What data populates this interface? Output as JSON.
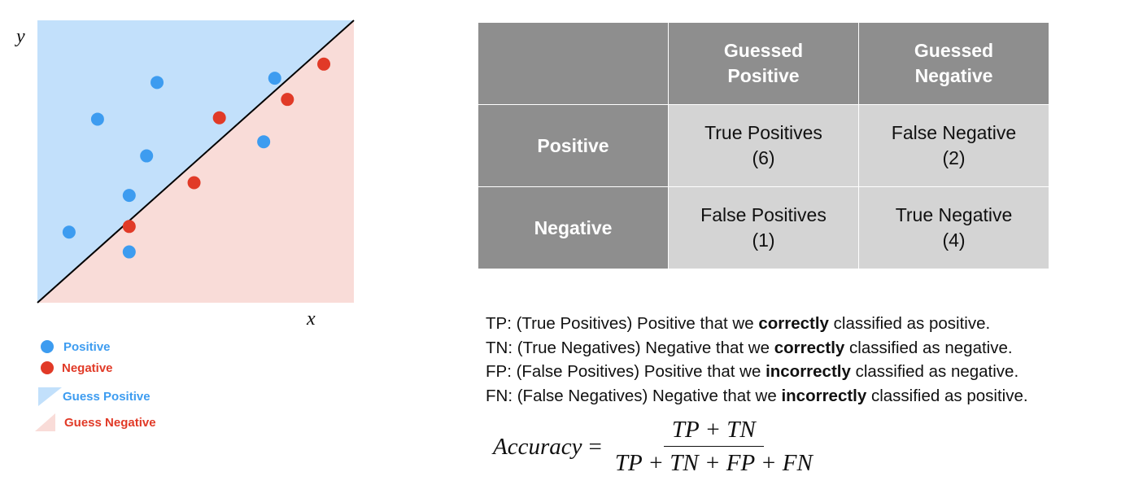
{
  "scatter": {
    "y_label": "y",
    "x_label": "x",
    "colors": {
      "positive": "#3d9cf0",
      "negative": "#e13a27",
      "guess_positive_region": "#c2e0fb",
      "guess_negative_region": "#f9dcd8",
      "boundary": "#000000"
    },
    "points": [
      {
        "class": "positive",
        "x": 0.1,
        "y": 0.25
      },
      {
        "class": "positive",
        "x": 0.19,
        "y": 0.65
      },
      {
        "class": "positive",
        "x": 0.378,
        "y": 0.78
      },
      {
        "class": "positive",
        "x": 0.29,
        "y": 0.38
      },
      {
        "class": "positive",
        "x": 0.345,
        "y": 0.52
      },
      {
        "class": "positive",
        "x": 0.29,
        "y": 0.18
      },
      {
        "class": "positive",
        "x": 0.715,
        "y": 0.57
      },
      {
        "class": "positive",
        "x": 0.75,
        "y": 0.795
      },
      {
        "class": "negative",
        "x": 0.29,
        "y": 0.27
      },
      {
        "class": "negative",
        "x": 0.495,
        "y": 0.425
      },
      {
        "class": "negative",
        "x": 0.575,
        "y": 0.655
      },
      {
        "class": "negative",
        "x": 0.79,
        "y": 0.72
      },
      {
        "class": "negative",
        "x": 0.905,
        "y": 0.845
      }
    ]
  },
  "legend": [
    {
      "key": "positive",
      "shape": "dot",
      "label": "Positive"
    },
    {
      "key": "negative",
      "shape": "dot",
      "label": "Negative"
    },
    {
      "key": "guess_positive_region",
      "shape": "triangle-upper",
      "label": "Guess Positive"
    },
    {
      "key": "guess_negative_region",
      "shape": "triangle-lower",
      "label": "Guess Negative"
    }
  ],
  "matrix": {
    "col_headers": [
      {
        "line1": "Guessed",
        "line2": "Positive"
      },
      {
        "line1": "Guessed",
        "line2": "Negative"
      }
    ],
    "rows": [
      {
        "header": "Positive",
        "cells": [
          {
            "line1": "True Positives",
            "line2": "(6)"
          },
          {
            "line1": "False Negative",
            "line2": "(2)"
          }
        ]
      },
      {
        "header": "Negative",
        "cells": [
          {
            "line1": "False Positives",
            "line2": "(1)"
          },
          {
            "line1": "True Negative",
            "line2": "(4)"
          }
        ]
      }
    ]
  },
  "definitions": [
    {
      "prefix": "TP: (True Positives)  Positive that we ",
      "bold": "correctly",
      "suffix": " classified as positive."
    },
    {
      "prefix": "TN: (True Negatives)  Negative that we ",
      "bold": "correctly",
      "suffix": " classified as negative."
    },
    {
      "prefix": "FP: (False Positives)  Positive that we ",
      "bold": "incorrectly",
      "suffix": " classified as negative."
    },
    {
      "prefix": "FN: (False Negatives)  Negative that we ",
      "bold": "incorrectly",
      "suffix": " classified as positive."
    }
  ],
  "formula": {
    "lhs": "Accuracy",
    "equals": "=",
    "numerator": "TP + TN",
    "denominator": "TP + TN + FP + FN"
  }
}
